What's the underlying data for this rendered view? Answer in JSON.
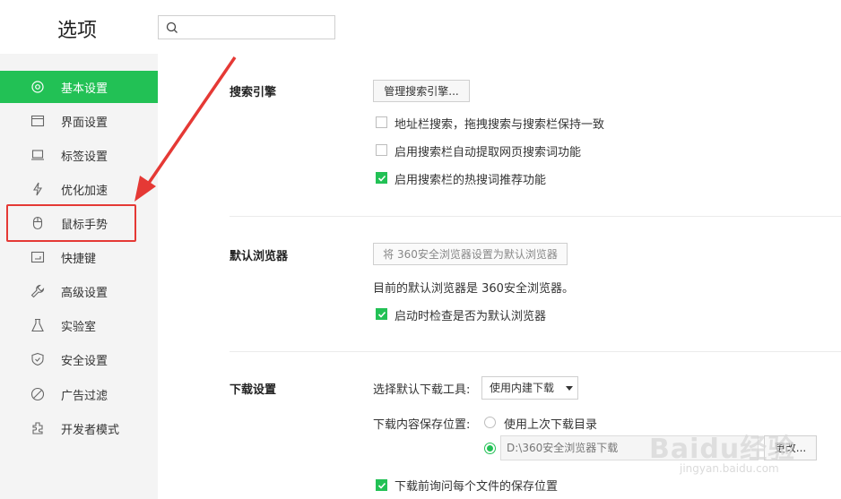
{
  "header": {
    "title": "选项",
    "search": {
      "placeholder": "",
      "icon": "search-icon"
    }
  },
  "sidebar": {
    "active_color": "#22c155",
    "items": [
      {
        "label": "基本设置",
        "icon": "gear-icon",
        "active": true
      },
      {
        "label": "界面设置",
        "icon": "window-icon",
        "active": false
      },
      {
        "label": "标签设置",
        "icon": "tab-icon",
        "active": false
      },
      {
        "label": "优化加速",
        "icon": "lightning-icon",
        "active": false
      },
      {
        "label": "鼠标手势",
        "icon": "mouse-icon",
        "active": false
      },
      {
        "label": "快捷键",
        "icon": "keyboard-icon",
        "active": false
      },
      {
        "label": "高级设置",
        "icon": "wrench-icon",
        "active": false
      },
      {
        "label": "实验室",
        "icon": "flask-icon",
        "active": false
      },
      {
        "label": "安全设置",
        "icon": "shield-icon",
        "active": false
      },
      {
        "label": "广告过滤",
        "icon": "block-icon",
        "active": false
      },
      {
        "label": "开发者模式",
        "icon": "puzzle-icon",
        "active": false
      }
    ]
  },
  "search_engine": {
    "title": "搜索引擎",
    "manage_button": "管理搜索引擎...",
    "options": [
      {
        "label": "地址栏搜索，拖拽搜索与搜索栏保持一致",
        "checked": false
      },
      {
        "label": "启用搜索栏自动提取网页搜索词功能",
        "checked": false
      },
      {
        "label": "启用搜索栏的热搜词推荐功能",
        "checked": true
      }
    ]
  },
  "default_browser": {
    "title": "默认浏览器",
    "set_button": "将 360安全浏览器设置为默认浏览器",
    "status": "目前的默认浏览器是 360安全浏览器。",
    "check_option": {
      "label": "启动时检查是否为默认浏览器",
      "checked": true
    }
  },
  "download": {
    "title": "下载设置",
    "tool_label": "选择默认下载工具:",
    "tool_value": "使用内建下载",
    "location_label": "下载内容保存位置:",
    "radio_last": "使用上次下载目录",
    "path_value": "D:\\360安全浏览器下载",
    "change_button": "更改...",
    "ask_option": {
      "label": "下载前询问每个文件的保存位置",
      "checked": true
    }
  },
  "watermark": {
    "brand": "Baidu经验",
    "url": "jingyan.baidu.com"
  }
}
